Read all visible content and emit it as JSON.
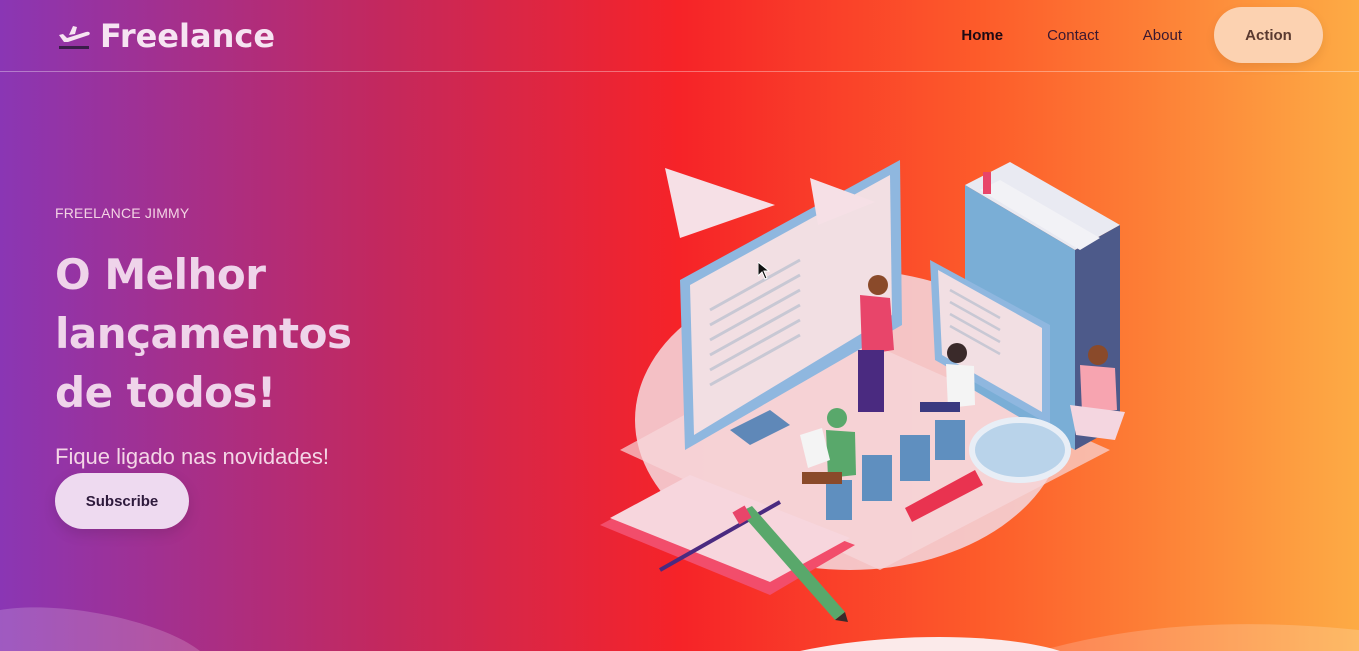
{
  "brand": {
    "name": "Freelance",
    "icon": "plane-departure-icon"
  },
  "nav": {
    "links": [
      {
        "label": "Home",
        "active": true
      },
      {
        "label": "Contact",
        "active": false
      },
      {
        "label": "About",
        "active": false
      }
    ],
    "action_label": "Action"
  },
  "hero": {
    "eyebrow": "FREELANCE JIMMY",
    "headline_line1": "O Melhor lançamentos",
    "headline_line2": "de todos!",
    "subtitle": "Fique ligado nas novidades!",
    "subscribe_label": "Subscribe"
  },
  "colors": {
    "gradient": [
      "#8a36b4",
      "#c3285e",
      "#f62328",
      "#fd5b2a",
      "#fdab45"
    ],
    "action_button": "#fcd2b1",
    "subscribe_button": "#eedaf0"
  }
}
